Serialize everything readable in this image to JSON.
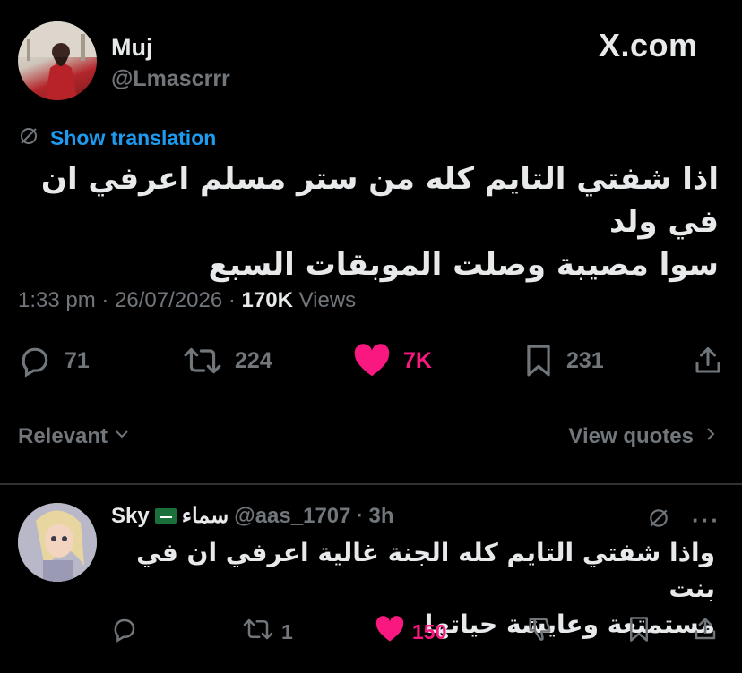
{
  "author": {
    "name": "Muj",
    "handle": "@Lmascrrr"
  },
  "brand": "X.com",
  "translation_label": "Show translation",
  "tweet": {
    "lines": [
      "اذا شفتي التايم كله من ستر مسلم اعرفي ان في ولد",
      "سوا مصيبة وصلت الموبقات السبع"
    ]
  },
  "meta": {
    "time": "1:33 pm",
    "sep": "·",
    "date": "26/07/2026",
    "views_count": "170K",
    "views_label": "Views"
  },
  "stats": {
    "replies": "71",
    "reposts": "224",
    "likes": "7K",
    "bookmarks": "231"
  },
  "sort_label": "Relevant",
  "quotes_label": "View quotes",
  "reply": {
    "name_latin": "Sky",
    "name_arabic": "سماء",
    "handle": "@aas_1707",
    "sep": "·",
    "time": "3h",
    "lines": [
      "واذا شفتي التايم كله الجنة غالية اعرفي ان في بنت",
      "مستمتعة وعايشة حياتها"
    ],
    "reposts": "1",
    "likes": "150",
    "more": "···"
  },
  "colors": {
    "accent": "#1d9bf0",
    "like": "#f91880",
    "muted": "#71767b",
    "text": "#e7e9ea",
    "divider": "#2f3336"
  }
}
